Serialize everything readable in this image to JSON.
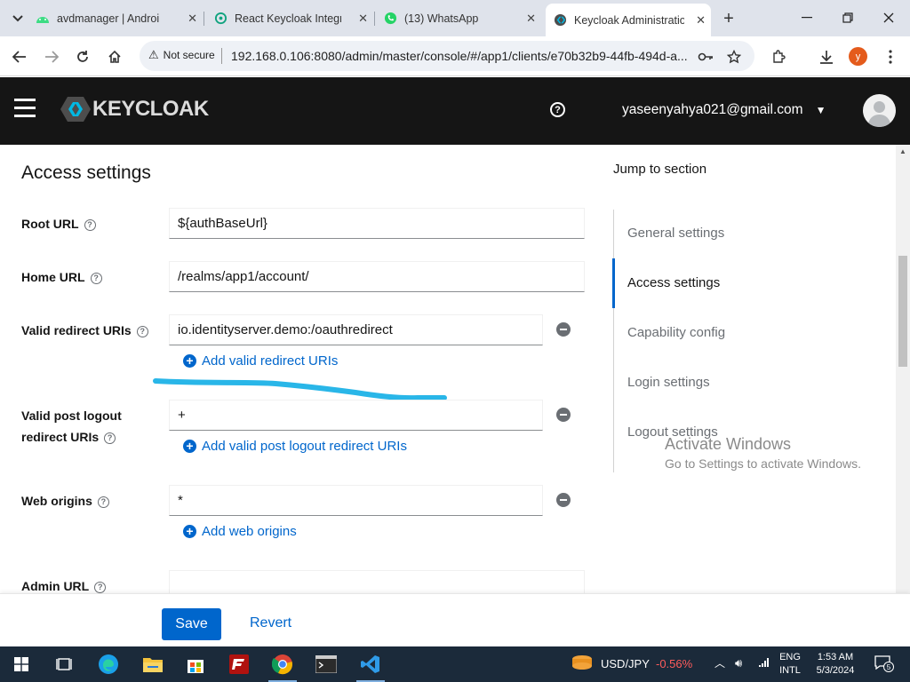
{
  "browser": {
    "tabs": [
      {
        "title": "avdmanager | Androi",
        "icon": "android-studio-icon"
      },
      {
        "title": "React Keycloak Integra",
        "icon": "chatgpt-icon"
      },
      {
        "title": "(13) WhatsApp",
        "icon": "whatsapp-icon"
      },
      {
        "title": "Keycloak Administratio",
        "icon": "keycloak-icon"
      }
    ],
    "security_label": "Not secure",
    "url": "192.168.0.106:8080/admin/master/console/#/app1/clients/e70b32b9-44fb-494d-a...",
    "profile_initial": "y"
  },
  "header": {
    "brand": "KEYCLOAK",
    "user_email": "yaseenyahya021@gmail.com"
  },
  "section": {
    "title": "Access settings"
  },
  "fields": {
    "root_url": {
      "label": "Root URL",
      "value": "${authBaseUrl}"
    },
    "home_url": {
      "label": "Home URL",
      "value": "/realms/app1/account/"
    },
    "redirect_uris": {
      "label": "Valid redirect URIs",
      "value": "io.identityserver.demo:/oauthredirect",
      "add_label": "Add valid redirect URIs"
    },
    "post_logout": {
      "label_line1": "Valid post logout",
      "label_line2": "redirect URIs",
      "value": "+",
      "add_label": "Add valid post logout redirect URIs"
    },
    "web_origins": {
      "label": "Web origins",
      "value": "*",
      "add_label": "Add web origins"
    },
    "admin_url": {
      "label": "Admin URL",
      "value": ""
    }
  },
  "jump": {
    "title": "Jump to section",
    "items": [
      "General settings",
      "Access settings",
      "Capability config",
      "Login settings",
      "Logout settings"
    ],
    "active": "Access settings"
  },
  "actions": {
    "save": "Save",
    "revert": "Revert"
  },
  "watermark": {
    "line1": "Activate Windows",
    "line2": "Go to Settings to activate Windows."
  },
  "taskbar": {
    "ticker_name": "USD/JPY",
    "ticker_change": "-0.56%",
    "lang_line1": "ENG",
    "lang_line2": "INTL",
    "time": "1:53 AM",
    "date": "5/3/2024",
    "notifications": "5"
  },
  "colors": {
    "accent": "#0066cc",
    "header_bg": "#151515",
    "annotation": "#29b6e8",
    "ticker_down": "#ff5c5c"
  }
}
